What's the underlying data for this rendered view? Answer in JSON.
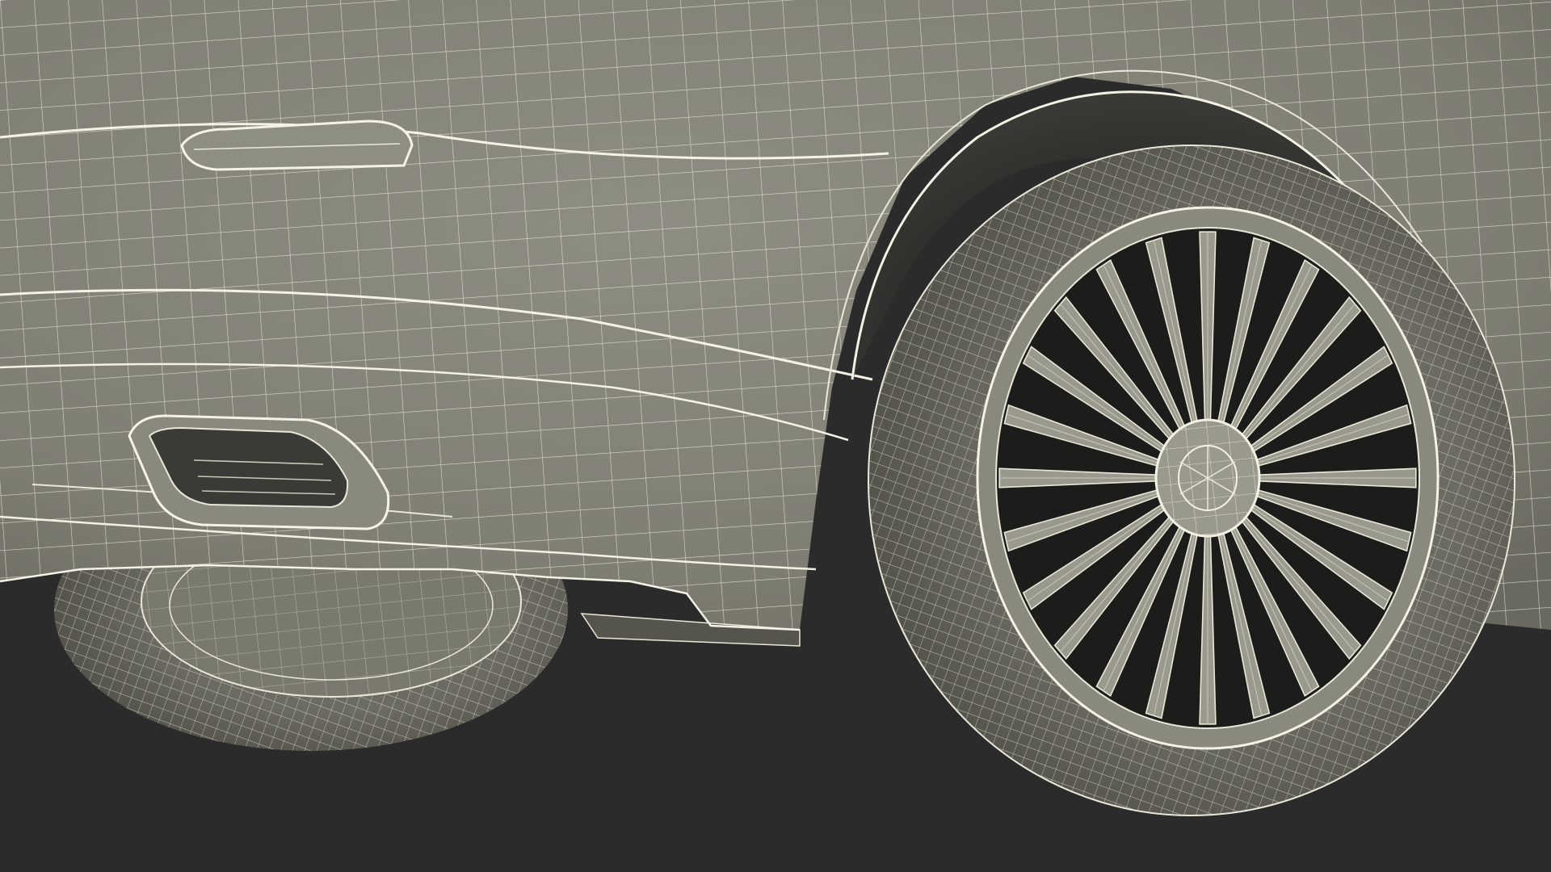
{
  "scene": {
    "subject": "car-rear-quarter-wireframe",
    "view": "wireframe-on-shaded",
    "colors": {
      "background": "#2b2b2b",
      "surface": "#7f7e73",
      "surface_light": "#8e8d82",
      "surface_dark": "#5f5e56",
      "wire": "#e9e8d8",
      "wire_dim": "#c9c8b8",
      "tire": "#6c6b62",
      "tire_dark": "#4e4d46",
      "cavity": "#1c1c1b",
      "rim": "#9a998d"
    },
    "wheel_spokes": 24
  }
}
